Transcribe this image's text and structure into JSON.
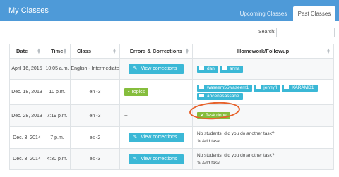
{
  "header": {
    "title": "My Classes",
    "tabs": [
      {
        "label": "Upcoming Classes",
        "active": false
      },
      {
        "label": "Past Classes",
        "active": true
      }
    ]
  },
  "search": {
    "label": "Search:",
    "value": ""
  },
  "table": {
    "columns": [
      "Date",
      "Time",
      "Class",
      "Errors & Corrections",
      "Homework/Followup"
    ],
    "rows": [
      {
        "date": "April 16, 2015",
        "time": "10:05 a.m.",
        "class": "English - Intermediate",
        "errors": "View corrections",
        "homework": [
          "dan",
          "anna"
        ]
      },
      {
        "date": "Dec. 18, 2013",
        "time": "10 p.m.",
        "class": "en -3",
        "errors": "Topics",
        "homework": [
          "waseem55waseem1",
          "jennyfl",
          "KARAMD1",
          "ahcenesassane"
        ]
      },
      {
        "date": "Dec. 28, 2013",
        "time": "7:19 p.m.",
        "class": "en -3",
        "errors": "--",
        "homework": "Task done"
      },
      {
        "date": "Dec. 3, 2014",
        "time": "7 p.m.",
        "class": "es -2",
        "errors": "View corrections",
        "homework_note": "No students, did you do another task?",
        "add_task": "Add task"
      },
      {
        "date": "Dec. 3, 2014",
        "time": "4:30 p.m.",
        "class": "es -3",
        "errors": "View corrections",
        "homework_note": "No students, did you do another task?",
        "add_task": "Add task"
      }
    ]
  },
  "colors": {
    "header": "#4e9ad8",
    "button": "#3bb8d6",
    "success": "#85bd3c",
    "highlight": "#e7612a"
  },
  "icons": [
    "pencil-icon",
    "envelope-icon",
    "check-icon",
    "sort-icon"
  ]
}
